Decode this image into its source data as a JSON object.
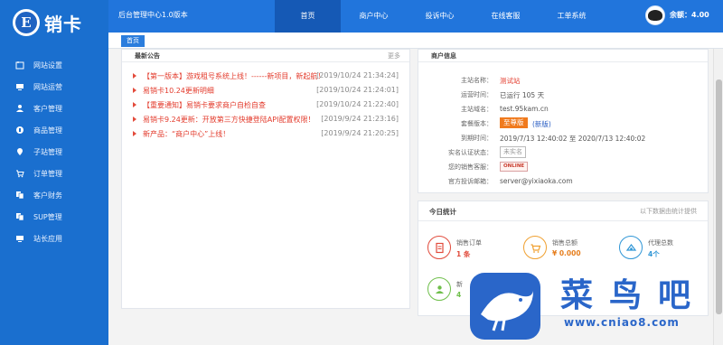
{
  "app": {
    "logo_letter": "E",
    "logo_text": "销卡",
    "title": "后台管理中心1.0版本",
    "balance": "余额：4.00"
  },
  "top_nav": [
    {
      "label": "首页",
      "active": true
    },
    {
      "label": "商户中心",
      "active": false
    },
    {
      "label": "投诉中心",
      "active": false
    },
    {
      "label": "在线客服",
      "active": false
    },
    {
      "label": "工单系统",
      "active": false
    }
  ],
  "sidebar": {
    "items": [
      {
        "label": "网站设置",
        "icon": "folder-icon"
      },
      {
        "label": "网站运营",
        "icon": "monitor-icon"
      },
      {
        "label": "客户管理",
        "icon": "user-icon"
      },
      {
        "label": "商品管理",
        "icon": "product-icon"
      },
      {
        "label": "子站管理",
        "icon": "location-icon"
      },
      {
        "label": "订单管理",
        "icon": "cart-icon"
      },
      {
        "label": "客户财务",
        "icon": "copy-icon"
      },
      {
        "label": "SUP管理",
        "icon": "copy-icon"
      },
      {
        "label": "站长应用",
        "icon": "monitor-icon"
      }
    ]
  },
  "breadcrumb": {
    "tab": "首页"
  },
  "notices": {
    "title": "最新公告",
    "more": "更多",
    "items": [
      {
        "text": "【第一版本】游戏租号系统上线！------新项目，新起航！",
        "date": "[2019/10/24 21:34:24]"
      },
      {
        "text": "易销卡10.24更新明细",
        "date": "[2019/10/24 21:24:01]"
      },
      {
        "text": "【重要通知】易销卡要求商户自检自查",
        "date": "[2019/10/24 21:22:40]"
      },
      {
        "text": "易销卡9.24更新：开放第三方快捷登陆API配置权限！",
        "date": "[2019/9/24 21:23:16]"
      },
      {
        "text": "新产品：“商户中心”上线！",
        "date": "[2019/9/24 21:20:25]"
      }
    ]
  },
  "merchant": {
    "title": "商户信息",
    "rows": [
      {
        "label": "主站名称：",
        "value": "测试站"
      },
      {
        "label": "运营时间：",
        "value": "已运行 105 天"
      },
      {
        "label": "主站域名：",
        "value": "test.95kam.cn"
      },
      {
        "label": "套餐版本：",
        "value": "至尊版",
        "extra": "(新版)"
      },
      {
        "label": "到期时间：",
        "value": "2019/7/13 12:40:02 至 2020/7/13 12:40:02"
      },
      {
        "label": "实名认证状态：",
        "value": "未实名"
      },
      {
        "label": "您的销售客服：",
        "value": "ONLINE"
      },
      {
        "label": "官方投诉邮箱：",
        "value": "server@yixiaoka.com"
      }
    ]
  },
  "stats": {
    "title": "今日统计",
    "subtitle": "以下数据由统计提供",
    "items": [
      {
        "label": "销售订单",
        "value": "1 条",
        "color": "#e14b3c",
        "icon": "document-icon"
      },
      {
        "label": "销售总额",
        "value": "¥ 0.000",
        "color": "#f0a030",
        "icon": "cart-icon"
      },
      {
        "label": "代理总数",
        "value": "4个",
        "color": "#2f96d6",
        "icon": "agent-icon"
      },
      {
        "label": "新",
        "value": "4",
        "color": "#6fbf4b",
        "icon": "user-icon"
      }
    ]
  },
  "watermark": {
    "text": "菜鸟吧",
    "url": "www.cniao8.com"
  },
  "colors": {
    "sidebar": "#1a6fcf",
    "topbar": "#2175dc",
    "top_active": "#1559b5",
    "notice_red": "#e33b2c"
  }
}
